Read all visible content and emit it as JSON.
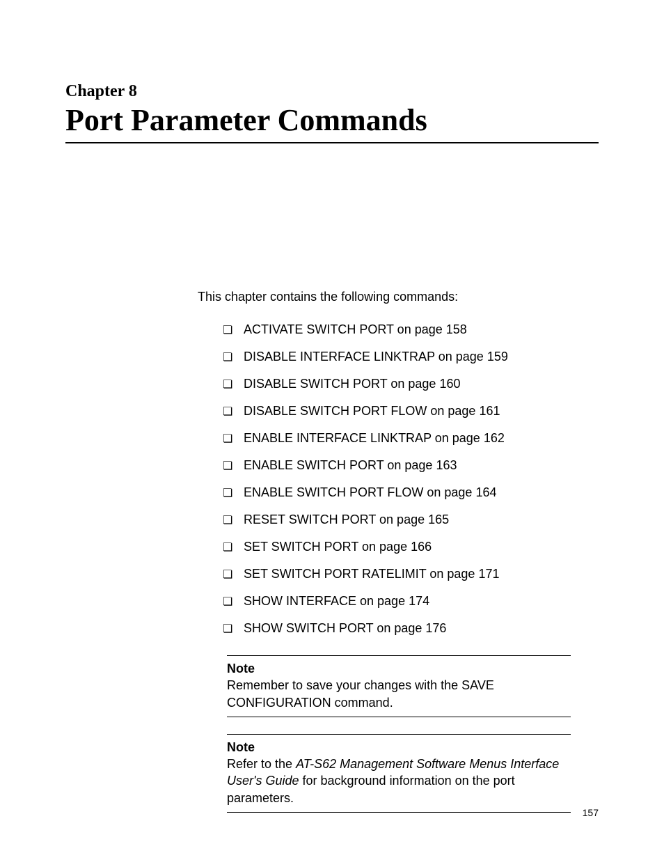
{
  "chapter": {
    "label": "Chapter 8",
    "title": "Port Parameter Commands"
  },
  "intro": "This chapter contains the following commands:",
  "commands": [
    "ACTIVATE SWITCH PORT on page 158",
    "DISABLE INTERFACE LINKTRAP on page 159",
    "DISABLE SWITCH PORT on page 160",
    "DISABLE SWITCH PORT FLOW on page 161",
    "ENABLE INTERFACE LINKTRAP on page 162",
    "ENABLE SWITCH PORT on page 163",
    "ENABLE SWITCH PORT FLOW on page 164",
    "RESET SWITCH PORT on page 165",
    "SET SWITCH PORT on page 166",
    "SET SWITCH PORT RATELIMIT on page 171",
    "SHOW INTERFACE on page 174",
    "SHOW SWITCH PORT on page 176"
  ],
  "notes": [
    {
      "label": "Note",
      "body_prefix": "Remember to save your changes with the SAVE CONFIGURATION command.",
      "italic": "",
      "body_suffix": ""
    },
    {
      "label": "Note",
      "body_prefix": "Refer to the ",
      "italic": "AT-S62 Management Software Menus Interface User's Guide",
      "body_suffix": " for background information on the port parameters."
    }
  ],
  "page_number": "157"
}
